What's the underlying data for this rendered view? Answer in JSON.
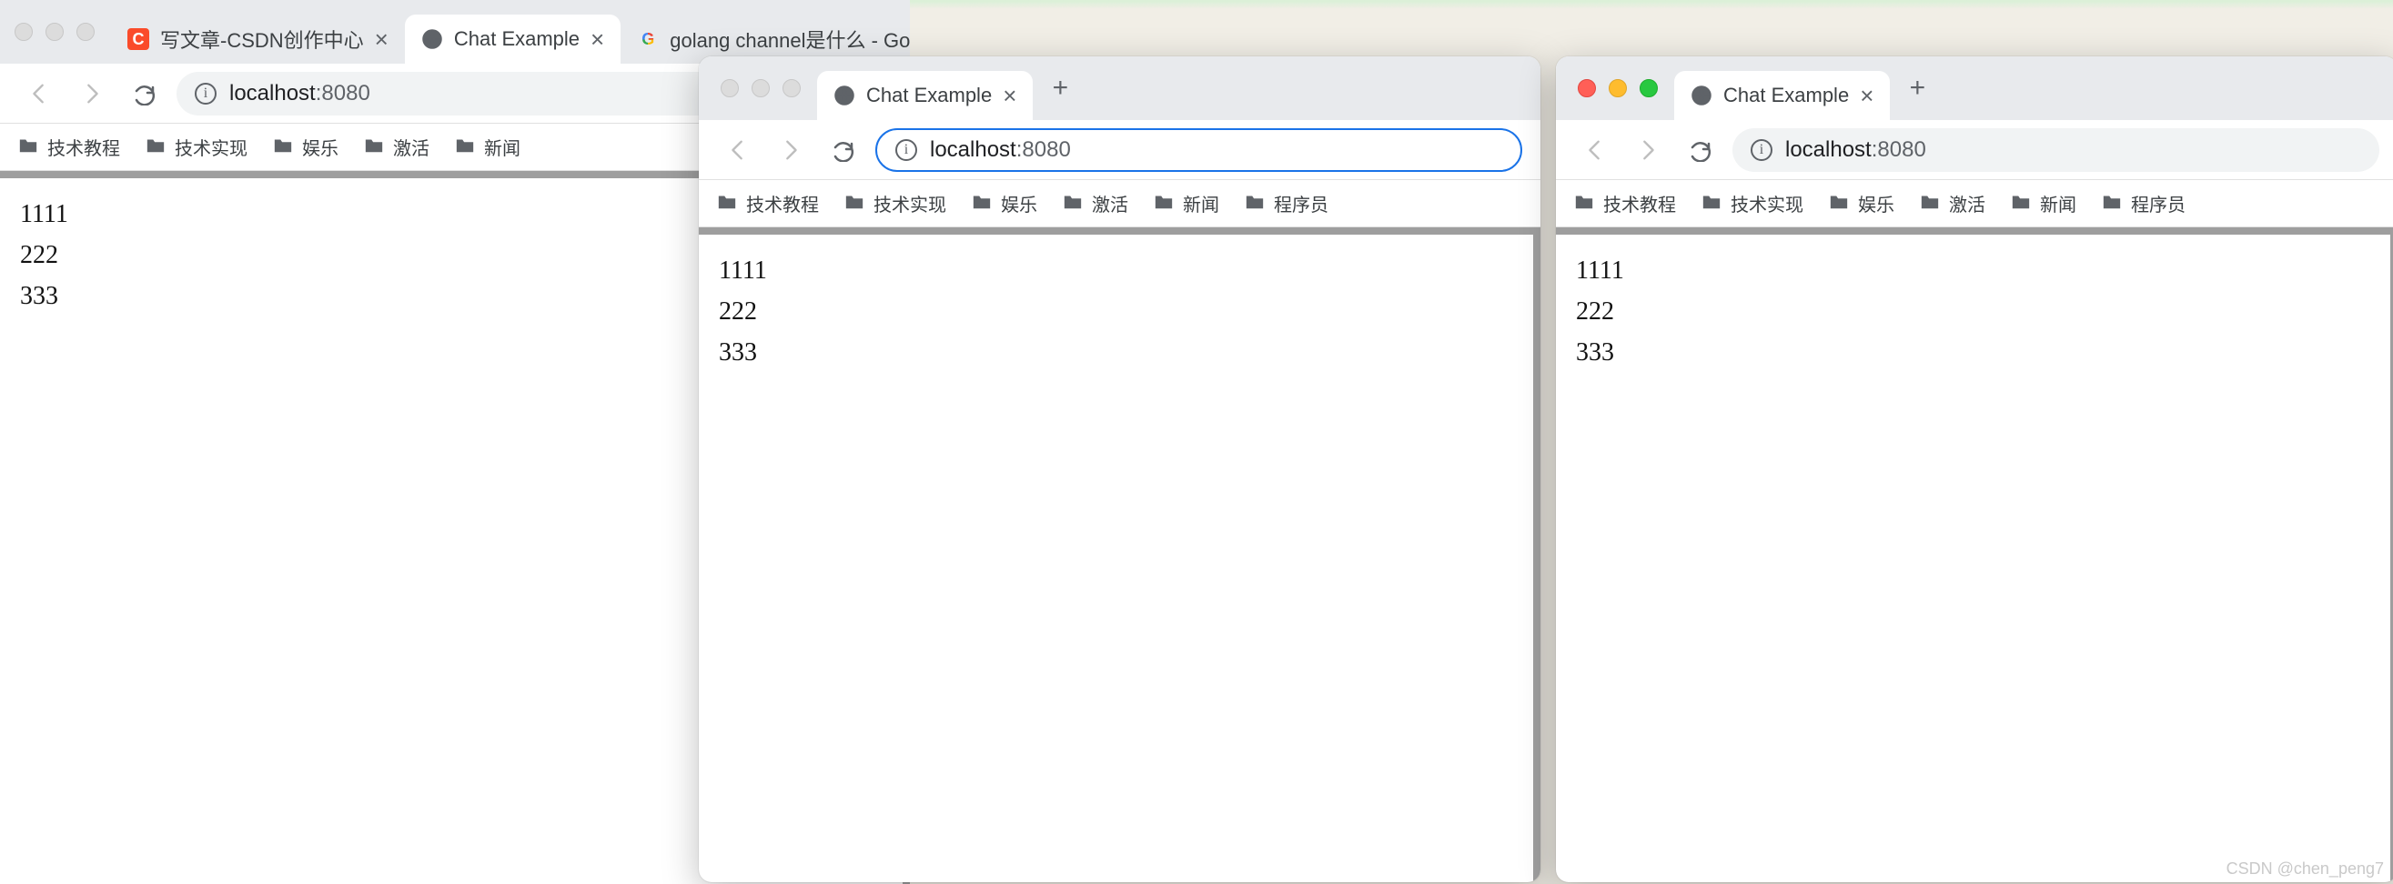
{
  "window1": {
    "traffic_active": false,
    "tabs": [
      {
        "favicon": "c",
        "label": "写文章-CSDN创作中心",
        "active": false
      },
      {
        "favicon": "globe",
        "label": "Chat Example",
        "active": true
      },
      {
        "favicon": "google",
        "label": "golang channel是什么 - Google",
        "active": false
      }
    ],
    "new_tab": "+",
    "url_host": "localhost",
    "url_port": ":8080",
    "bookmarks": [
      "技术教程",
      "技术实现",
      "娱乐",
      "激活",
      "新闻"
    ],
    "lines": [
      "1111",
      "222",
      "333"
    ]
  },
  "window2": {
    "traffic_active": false,
    "tabs": [
      {
        "favicon": "globe",
        "label": "Chat Example",
        "active": true
      }
    ],
    "new_tab": "+",
    "url_host": "localhost",
    "url_port": ":8080",
    "url_focused": true,
    "bookmarks": [
      "技术教程",
      "技术实现",
      "娱乐",
      "激活",
      "新闻",
      "程序员"
    ],
    "lines": [
      "1111",
      "222",
      "333"
    ]
  },
  "window3": {
    "traffic_active": true,
    "tabs": [
      {
        "favicon": "globe",
        "label": "Chat Example",
        "active": true
      }
    ],
    "new_tab": "+",
    "url_host": "localhost",
    "url_port": ":8080",
    "bookmarks": [
      "技术教程",
      "技术实现",
      "娱乐",
      "激活",
      "新闻",
      "程序员"
    ],
    "lines": [
      "1111",
      "222",
      "333"
    ]
  },
  "close_glyph": "×",
  "watermark": "CSDN @chen_peng7"
}
